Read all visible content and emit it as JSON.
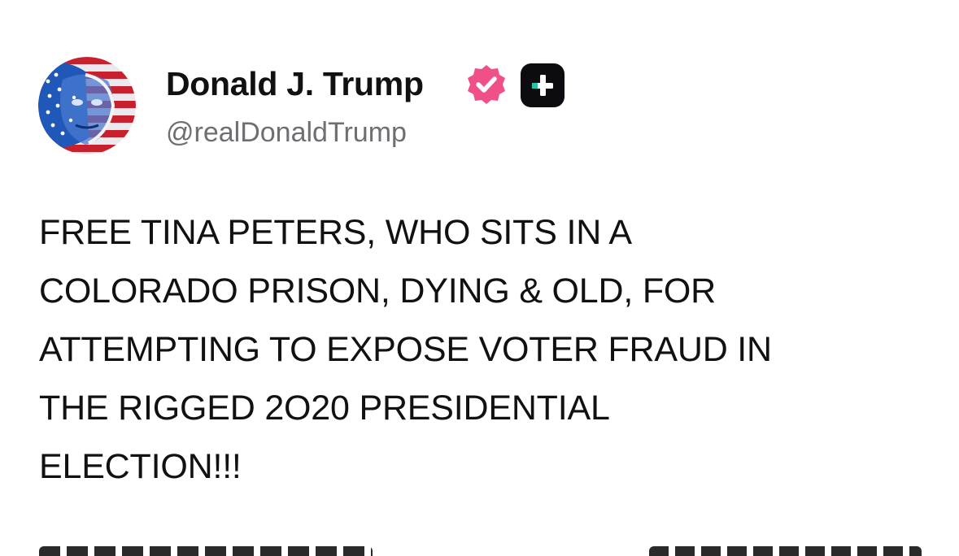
{
  "author": {
    "display_name": "Donald J. Trump",
    "handle": "@realDonaldTrump",
    "verified_badge_color": "#f0508a",
    "plus_badge_color": "#0c0c10",
    "plus_accent_color": "#27c3a5"
  },
  "post": {
    "text": "FREE TINA PETERS, WHO SITS IN A\nCOLORADO PRISON, DYING & OLD, FOR\nATTEMPTING TO EXPOSE VOTER FRAUD IN\nTHE RIGGED 2O20 PRESIDENTIAL\nELECTION!!!"
  },
  "icons": {
    "avatar": "avatar-image",
    "verified": "verified-badge-icon",
    "plus": "plus-badge-icon"
  }
}
